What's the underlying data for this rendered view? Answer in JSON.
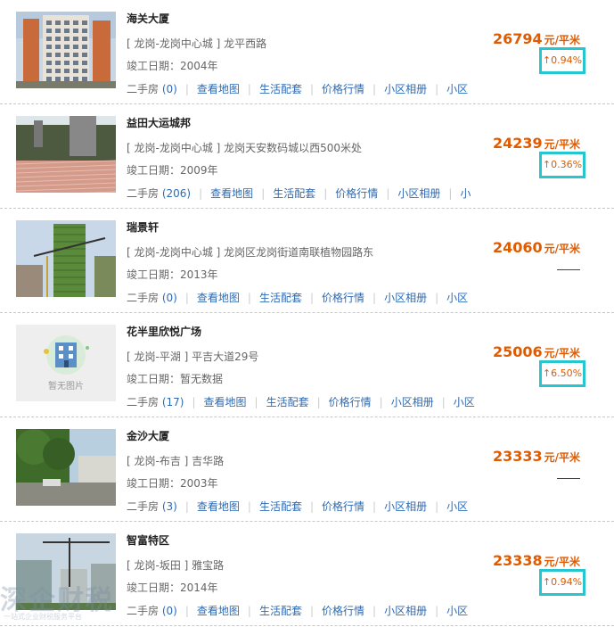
{
  "colors": {
    "price": "#e05a00",
    "link": "#2e6bb3",
    "highlight_box": "#26c6d0"
  },
  "listings": [
    {
      "name": "海关大厦",
      "area": "[ 龙岗-龙岗中心城 ] 龙平西路",
      "year": "竣工日期：2004年",
      "listings_label": "二手房",
      "listings_count": "(0)",
      "map": "查看地图",
      "amenities": "生活配套",
      "market": "价格行情",
      "album": "小区相册",
      "more": "小区",
      "price": "26794",
      "unit": "元/平米",
      "change": "↑0.94%",
      "thumb": "building-photo"
    },
    {
      "name": "益田大运城邦",
      "area": "[ 龙岗-龙岗中心城 ] 龙岗天安数码城以西500米处",
      "year": "竣工日期：2009年",
      "listings_label": "二手房",
      "listings_count": "(206)",
      "map": "查看地图",
      "amenities": "生活配套",
      "market": "价格行情",
      "album": "小区相册",
      "more": "小",
      "price": "24239",
      "unit": "元/平米",
      "change": "↑0.36%",
      "thumb": "plaza-photo"
    },
    {
      "name": "瑞景轩",
      "area": "[ 龙岗-龙岗中心城 ] 龙岗区龙岗街道南联植物园路东",
      "year": "竣工日期：2013年",
      "listings_label": "二手房",
      "listings_count": "(0)",
      "map": "查看地图",
      "amenities": "生活配套",
      "market": "价格行情",
      "album": "小区相册",
      "more": "小区",
      "price": "24060",
      "unit": "元/平米",
      "change": "",
      "thumb": "construction-photo"
    },
    {
      "name": "花半里欣悦广场",
      "area": "[ 龙岗-平湖 ] 平吉大道29号",
      "year": "竣工日期：暂无数据",
      "listings_label": "二手房",
      "listings_count": "(17)",
      "map": "查看地图",
      "amenities": "生活配套",
      "market": "价格行情",
      "album": "小区相册",
      "more": "小区",
      "price": "25006",
      "unit": "元/平米",
      "change": "↑6.50%",
      "thumb": "no-image",
      "no_image_text": "暂无图片"
    },
    {
      "name": "金沙大厦",
      "area": "[ 龙岗-布吉 ] 吉华路",
      "year": "竣工日期：2003年",
      "listings_label": "二手房",
      "listings_count": "(3)",
      "map": "查看地图",
      "amenities": "生活配套",
      "market": "价格行情",
      "album": "小区相册",
      "more": "小区",
      "price": "23333",
      "unit": "元/平米",
      "change": "",
      "thumb": "street-photo"
    },
    {
      "name": "智富特区",
      "area": "[ 龙岗-坂田 ] 雅宝路",
      "year": "竣工日期：2014年",
      "listings_label": "二手房",
      "listings_count": "(0)",
      "map": "查看地图",
      "amenities": "生活配套",
      "market": "价格行情",
      "album": "小区相册",
      "more": "小区",
      "price": "23338",
      "unit": "元/平米",
      "change": "↑0.94%",
      "thumb": "crane-photo"
    }
  ],
  "watermark": {
    "title": "深企财税",
    "subtitle": "一站式企业财税服务平台"
  }
}
